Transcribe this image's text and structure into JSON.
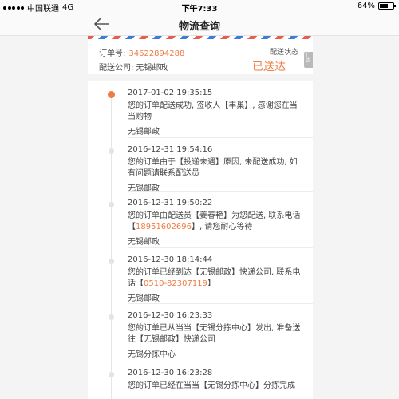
{
  "status_bar": {
    "carrier": "中国联通",
    "network": "4G",
    "time": "下午7:33",
    "battery_text": "64%",
    "battery_level": 0.64
  },
  "nav": {
    "title": "物流查询"
  },
  "order": {
    "number_label": "订单号:",
    "number": "34622894288",
    "company_label": "配送公司:",
    "company": "无锡邮政",
    "status_label": "配送状态",
    "status": "已送达",
    "ad_label": "广告"
  },
  "timeline": [
    {
      "time": "2017-01-02 19:35:15",
      "parts": [
        {
          "text": "您的订单配送成功, 签收人【丰巢】, 感谢您在当当购物",
          "hl": false
        }
      ],
      "who": "无锡邮政"
    },
    {
      "time": "2016-12-31 19:54:16",
      "parts": [
        {
          "text": "您的订单由于【投递未遇】原因, 未配送成功, 如有问题请联系配送员",
          "hl": false
        }
      ],
      "who": "无锡邮政"
    },
    {
      "time": "2016-12-31 19:50:22",
      "parts": [
        {
          "text": "您的订单由配送员【姜春艳】为您配送, 联系电话【",
          "hl": false
        },
        {
          "text": "18951602696",
          "hl": true
        },
        {
          "text": "】, 请您耐心等待",
          "hl": false
        }
      ],
      "who": "无锡邮政"
    },
    {
      "time": "2016-12-30 18:14:44",
      "parts": [
        {
          "text": "您的订单已经到达【无锡邮政】快递公司, 联系电话【",
          "hl": false
        },
        {
          "text": "0510-82307119",
          "hl": true
        },
        {
          "text": "】",
          "hl": false
        }
      ],
      "who": "无锡邮政"
    },
    {
      "time": "2016-12-30 16:23:33",
      "parts": [
        {
          "text": "您的订单已从当当【无锡分拣中心】发出, 准备送往【无锡邮政】快递公司",
          "hl": false
        }
      ],
      "who": "无锡分拣中心"
    },
    {
      "time": "2016-12-30 16:23:28",
      "parts": [
        {
          "text": "您的订单已经在当当【无锡分拣中心】分拣完成",
          "hl": false
        }
      ],
      "who": ""
    }
  ]
}
